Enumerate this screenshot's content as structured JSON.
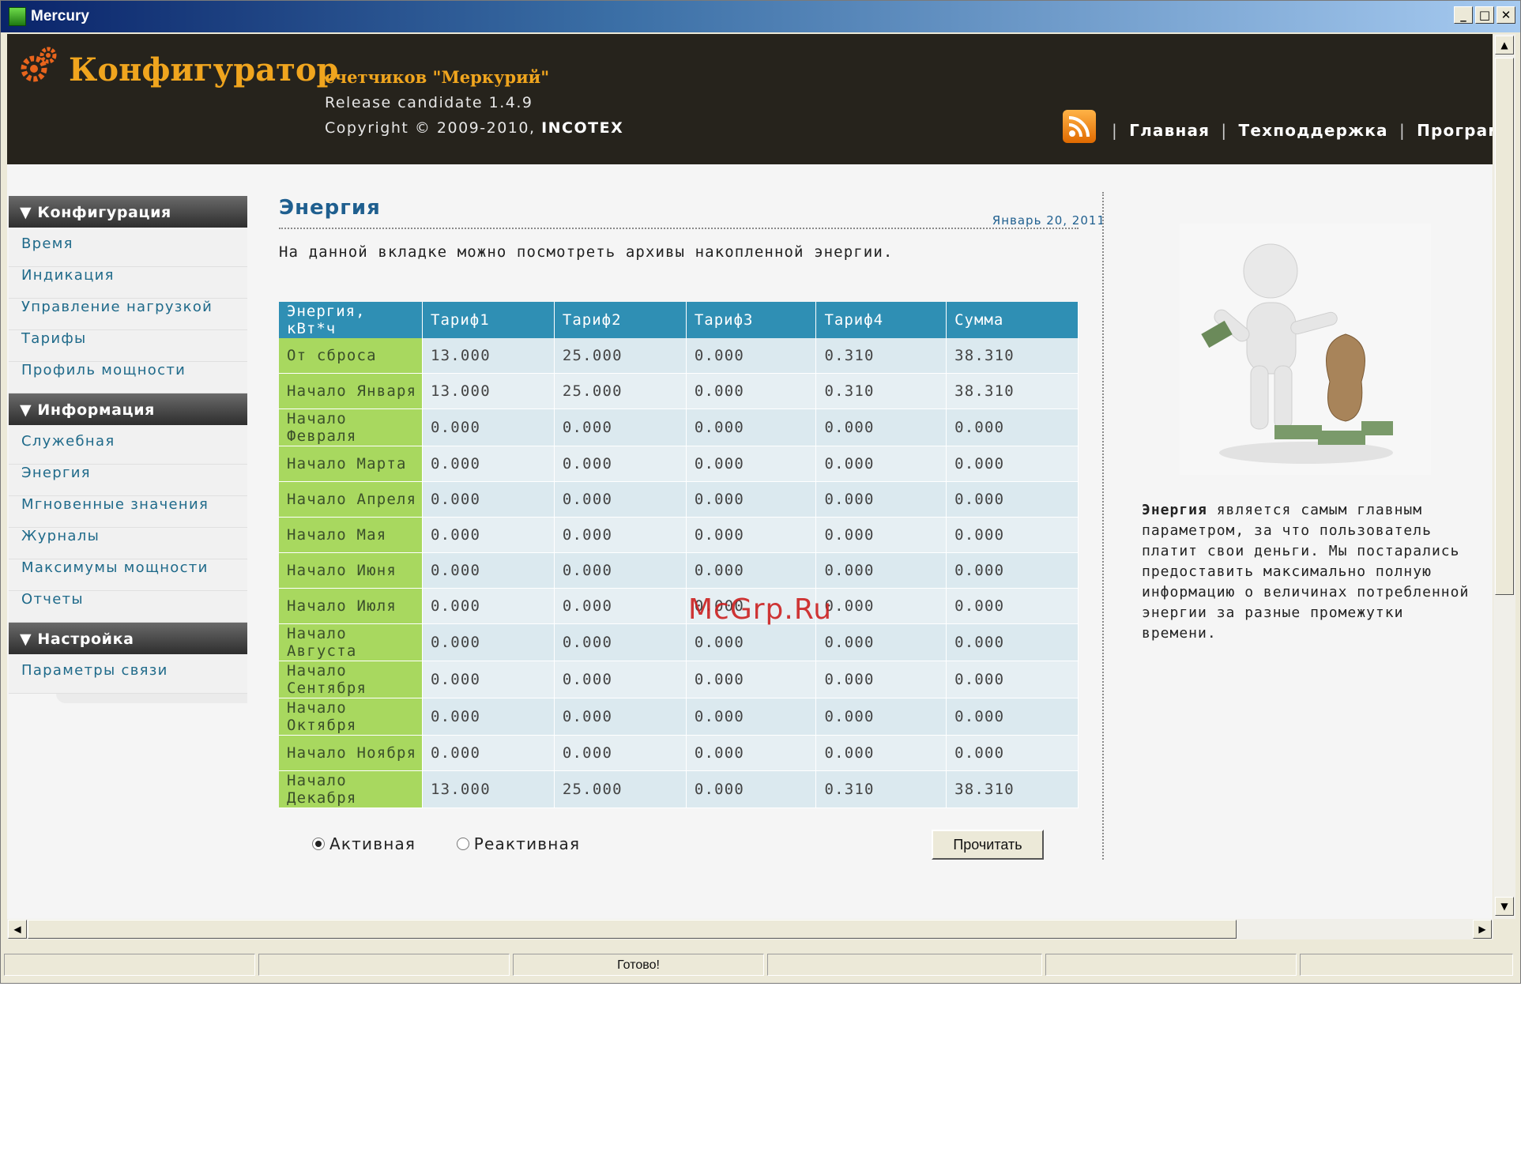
{
  "window": {
    "title": "Mercury",
    "controls": [
      "_",
      "□",
      "✕"
    ]
  },
  "header": {
    "app_name": "Конфигуратор",
    "subtitle": "счетчиков \"Меркурий\"",
    "release": "Release candidate 1.4.9",
    "copyright_prefix": "Copyright © 2009-2010, ",
    "copyright_company": "INCOTEX",
    "nav": [
      "Главная",
      "Техподдержка",
      "Программа"
    ],
    "separator": "|"
  },
  "sidebar": {
    "sections": [
      {
        "title": "▼ Конфигурация",
        "items": [
          "Время",
          "Индикация",
          "Управление нагрузкой",
          "Тарифы",
          "Профиль мощности"
        ]
      },
      {
        "title": "▼ Информация",
        "items": [
          "Служебная",
          "Энергия",
          "Мгновенные значения",
          "Журналы",
          "Максимумы мощности",
          "Отчеты"
        ]
      },
      {
        "title": "▼ Настройка",
        "items": [
          "Параметры связи"
        ]
      }
    ]
  },
  "main": {
    "title": "Энергия",
    "date": "Январь 20, 2011",
    "description": "На данной вкладке можно посмотреть архивы накопленной энергии.",
    "table": {
      "headers": [
        "Энергия, кВт*ч",
        "Тариф1",
        "Тариф2",
        "Тариф3",
        "Тариф4",
        "Сумма"
      ],
      "rows": [
        [
          "От сброса",
          "13.000",
          "25.000",
          "0.000",
          "0.310",
          "38.310"
        ],
        [
          "Начало Января",
          "13.000",
          "25.000",
          "0.000",
          "0.310",
          "38.310"
        ],
        [
          "Начало Февраля",
          "0.000",
          "0.000",
          "0.000",
          "0.000",
          "0.000"
        ],
        [
          "Начало Марта",
          "0.000",
          "0.000",
          "0.000",
          "0.000",
          "0.000"
        ],
        [
          "Начало Апреля",
          "0.000",
          "0.000",
          "0.000",
          "0.000",
          "0.000"
        ],
        [
          "Начало Мая",
          "0.000",
          "0.000",
          "0.000",
          "0.000",
          "0.000"
        ],
        [
          "Начало Июня",
          "0.000",
          "0.000",
          "0.000",
          "0.000",
          "0.000"
        ],
        [
          "Начало Июля",
          "0.000",
          "0.000",
          "0.000",
          "0.000",
          "0.000"
        ],
        [
          "Начало Августа",
          "0.000",
          "0.000",
          "0.000",
          "0.000",
          "0.000"
        ],
        [
          "Начало Сентября",
          "0.000",
          "0.000",
          "0.000",
          "0.000",
          "0.000"
        ],
        [
          "Начало Октября",
          "0.000",
          "0.000",
          "0.000",
          "0.000",
          "0.000"
        ],
        [
          "Начало Ноября",
          "0.000",
          "0.000",
          "0.000",
          "0.000",
          "0.000"
        ],
        [
          "Начало Декабря",
          "13.000",
          "25.000",
          "0.000",
          "0.310",
          "38.310"
        ]
      ]
    },
    "radio_active": "Активная",
    "radio_reactive": "Реактивная",
    "selected_radio": "Активная",
    "read_button": "Прочитать"
  },
  "side_panel": {
    "bold_lead": "Энергия",
    "text": " является самым главным параметром, за что пользователь платит свои деньги. Мы постарались предоставить максимально полную информацию о величинах потребленной энергии за разные промежутки времени."
  },
  "watermark": "McGrp.Ru",
  "statusbar": {
    "cells": [
      "",
      "",
      "Готово!",
      "",
      "",
      ""
    ]
  },
  "colors": {
    "header_bg": "#26231c",
    "brand_orange": "#f0a51e",
    "table_header": "#2f8fb4",
    "row_label_bg": "#a8d85f",
    "link": "#1f6a8a"
  }
}
